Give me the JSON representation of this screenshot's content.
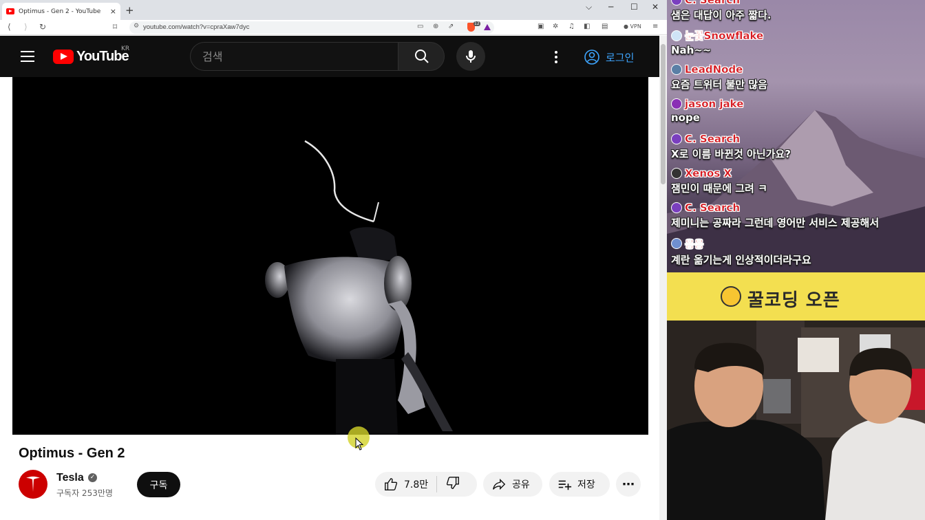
{
  "browser": {
    "tab_title": "Optimus - Gen 2 - YouTube",
    "tab_close": "×",
    "new_tab": "+",
    "url": "youtube.com/watch?v=cpraXaw7dyc",
    "shields_count": "12",
    "vpn_label": "VPN",
    "controls": {
      "min": "─",
      "max": "☐",
      "close": "✕",
      "list": "⌵"
    },
    "nav": {
      "back": "⟨",
      "forward": "⟩",
      "reload": "↻",
      "bookmark": "⌑"
    }
  },
  "youtube": {
    "logo_text": "YouTube",
    "region": "KR",
    "search_placeholder": "검색",
    "login_label": "로그인",
    "video_title": "Optimus - Gen 2",
    "channel_name": "Tesla",
    "subscribers": "구독자 253만명",
    "subscribe_label": "구독",
    "likes": "7.8만",
    "share_label": "공유",
    "save_label": "저장",
    "more": "⋯",
    "verified": "✓"
  },
  "chat": {
    "messages": [
      {
        "user": "C. Search",
        "text": "샘은 대답이 아주 짧다.",
        "icon_color": "#7a3fbf"
      },
      {
        "user": "눈꽃Snowflake",
        "text": "Nah~~",
        "icon_color": "#cfe4f7"
      },
      {
        "user": "LeadNode",
        "text": "요즘 트위터 불만 많음",
        "icon_color": "#5a7fa6"
      },
      {
        "user": "jason jake",
        "text": "nope",
        "icon_color": "#8a2fb5"
      },
      {
        "user": "C. Search",
        "text": "X로 이름 바뀐것 아닌가요?",
        "icon_color": "#7a3fbf"
      },
      {
        "user": "Xenos X",
        "text": "잼민이 때문에 그려 ㅋ",
        "icon_color": "#333333"
      },
      {
        "user": "C. Search",
        "text": "제미니는 공짜라 그런데 영어만 서비스 제공해서",
        "icon_color": "#7a3fbf"
      },
      {
        "user": "응응",
        "text": "계란 옮기는게 인상적이더라구요",
        "icon_color": "#6f8fd0"
      }
    ]
  },
  "banner": {
    "text": "꿀코딩 오픈"
  },
  "colors": {
    "yt_red": "#ff0000",
    "link_blue": "#3ea6ff",
    "chat_user": "#d6181f",
    "banner": "#f3df50"
  }
}
